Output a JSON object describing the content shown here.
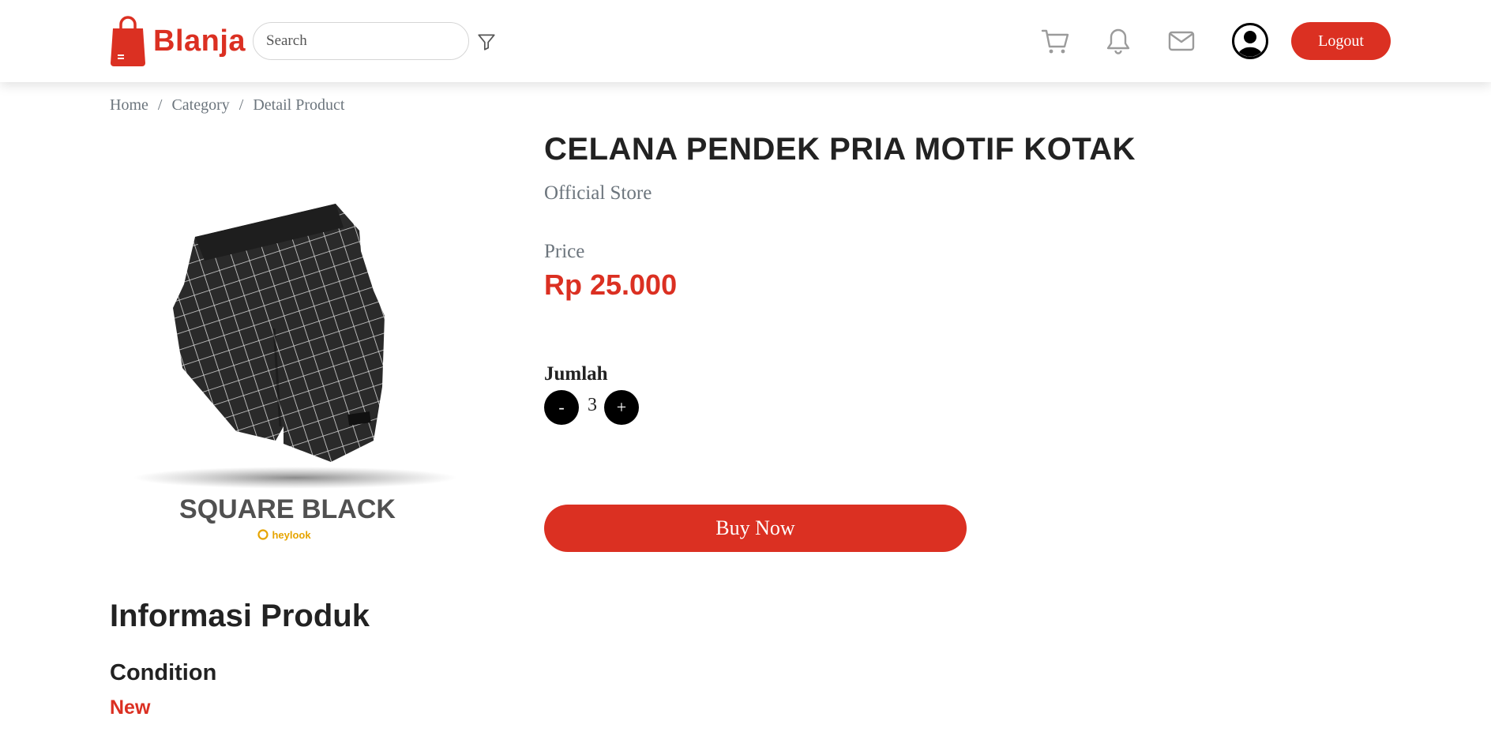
{
  "header": {
    "logo_text": "Blanja",
    "search_placeholder": "Search",
    "logout_label": "Logout",
    "icons": [
      "filter-icon",
      "cart-icon",
      "bell-icon",
      "mail-icon",
      "user-avatar-icon"
    ]
  },
  "breadcrumb": {
    "items": [
      "Home",
      "Category",
      "Detail Product"
    ],
    "separator": "/"
  },
  "product": {
    "name": "CELANA PENDEK PRIA MOTIF KOTAK",
    "store": "Official Store",
    "price_label": "Price",
    "price": "Rp 25.000",
    "image": {
      "caption": "SQUARE BLACK",
      "brand": "heylook"
    },
    "quantity_label": "Jumlah",
    "quantity": "3",
    "decrement_label": "-",
    "increment_label": "+",
    "buy_label": "Buy Now"
  },
  "info": {
    "title": "Informasi Produk",
    "condition_label": "Condition",
    "condition_value": "New"
  },
  "colors": {
    "accent": "#DB3022",
    "muted": "#6c757d",
    "text": "#222222"
  }
}
